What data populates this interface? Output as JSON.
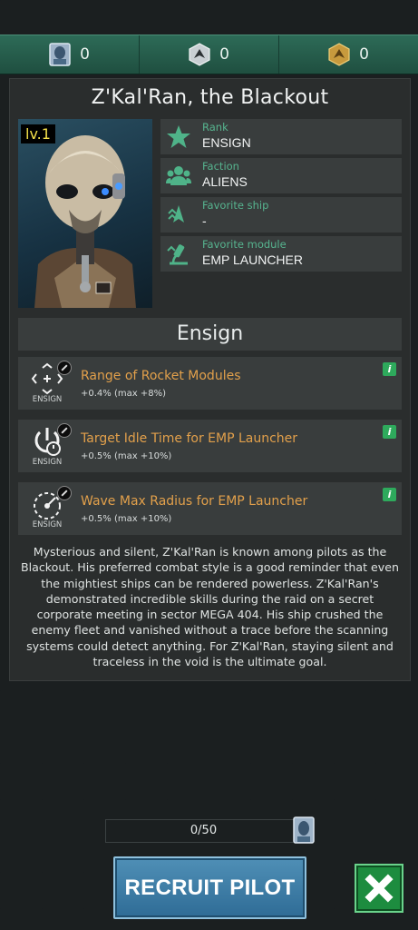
{
  "resources": [
    {
      "icon": "pilot-card-icon",
      "value": "0"
    },
    {
      "icon": "ship-badge-icon",
      "value": "0"
    },
    {
      "icon": "gold-badge-icon",
      "value": "0"
    }
  ],
  "pilot": {
    "name": "Z'Kal'Ran, the Blackout",
    "level": "lv.1",
    "info": [
      {
        "icon": "star-icon",
        "label": "Rank",
        "value": "ENSIGN"
      },
      {
        "icon": "users-icon",
        "label": "Faction",
        "value": "ALIENS"
      },
      {
        "icon": "ship-icon",
        "label": "Favorite ship",
        "value": "-"
      },
      {
        "icon": "module-icon",
        "label": "Favorite module",
        "value": "EMP LAUNCHER"
      }
    ],
    "rank_title": "Ensign"
  },
  "skills": [
    {
      "icon": "range-arrows-icon",
      "rank": "ENSIGN",
      "name": "Range of Rocket Modules",
      "value": "+0.4% (max +8%)"
    },
    {
      "icon": "idle-timer-icon",
      "rank": "ENSIGN",
      "name": "Target Idle Time for EMP Launcher",
      "value": "+0.5% (max +10%)"
    },
    {
      "icon": "radius-gauge-icon",
      "rank": "ENSIGN",
      "name": "Wave Max Radius for EMP Launcher",
      "value": "+0.5% (max +10%)"
    }
  ],
  "description": "Mysterious and silent, Z'Kal'Ran is known among pilots as the Blackout. His preferred combat style is a good reminder that even the mightiest ships can be rendered powerless. Z'Kal'Ran's demonstrated incredible skills during the raid on a secret corporate meeting in sector MEGA 404. His ship crushed the enemy fleet and vanished without a trace before the scanning systems could detect anything. For Z'Kal'Ran, staying silent and traceless in the void is the ultimate goal.",
  "progress": {
    "text": "0/50",
    "fraction": 0
  },
  "buttons": {
    "recruit": "RECRUIT PILOT",
    "info": "i"
  },
  "colors": {
    "accent": "#56b48f",
    "skill": "#e2a04b",
    "recruit": "#3a7ca6",
    "close": "#1d8c3f"
  }
}
